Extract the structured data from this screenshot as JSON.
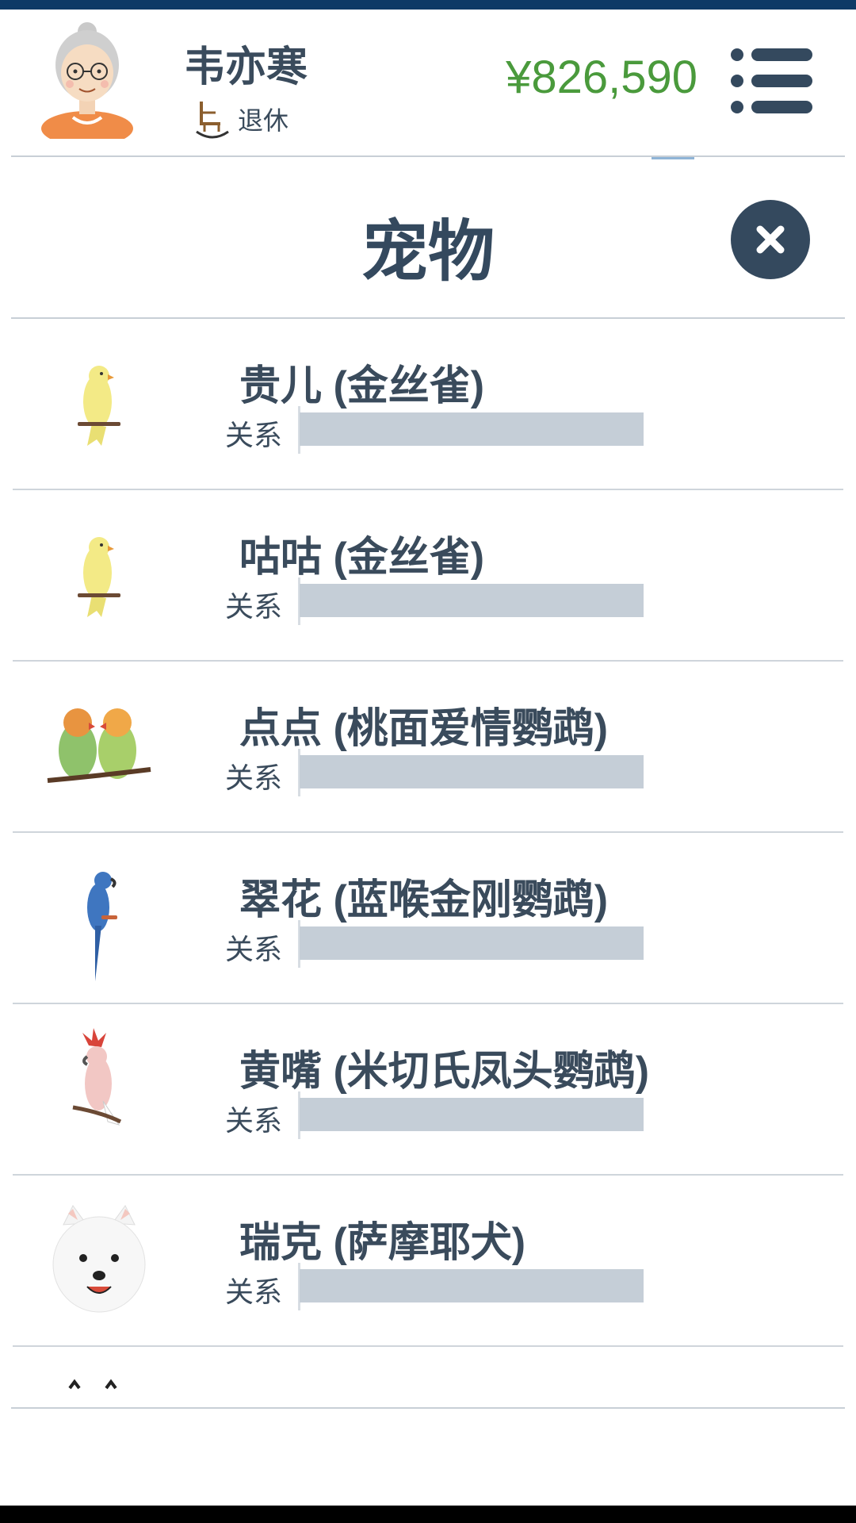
{
  "header": {
    "name": "韦亦寒",
    "status_icon": "rocking-chair-icon",
    "status": "退休",
    "money": "¥826,590",
    "menu_icon": "menu-icon",
    "accent_color": "#4a9a3c"
  },
  "panel": {
    "title": "宠物",
    "close_icon": "close-icon"
  },
  "pets": [
    {
      "name": "贵儿 (金丝雀)",
      "relation_label": "关系",
      "relation_level": 0,
      "icon": "canary-icon"
    },
    {
      "name": "咕咕 (金丝雀)",
      "relation_label": "关系",
      "relation_level": 0,
      "icon": "canary-icon"
    },
    {
      "name": "点点 (桃面爱情鹦鹉)",
      "relation_label": "关系",
      "relation_level": 0,
      "icon": "lovebird-pair-icon"
    },
    {
      "name": "翠花 (蓝喉金刚鹦鹉)",
      "relation_label": "关系",
      "relation_level": 0,
      "icon": "blue-macaw-icon"
    },
    {
      "name": "黄嘴 (米切氏凤头鹦鹉)",
      "relation_label": "关系",
      "relation_level": 0,
      "icon": "cockatoo-icon"
    },
    {
      "name": "瑞克 (萨摩耶犬)",
      "relation_label": "关系",
      "relation_level": 0,
      "icon": "samoyed-icon"
    }
  ]
}
